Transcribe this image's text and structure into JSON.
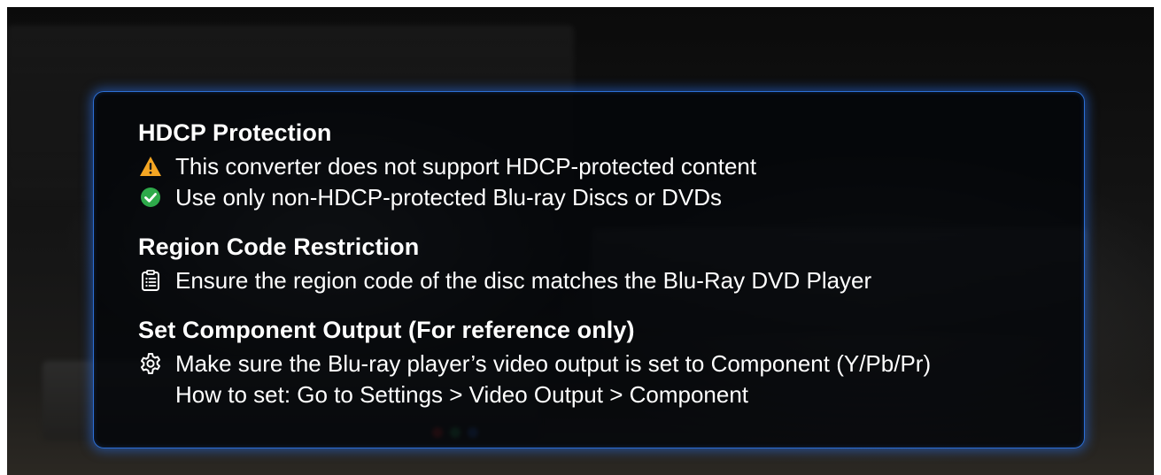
{
  "sections": [
    {
      "title": "HDCP Protection",
      "lines": [
        {
          "icon": "warning-icon",
          "text": "This converter does not support HDCP-protected content"
        },
        {
          "icon": "check-circle-icon",
          "text": "Use only non-HDCP-protected Blu-ray Discs or DVDs"
        }
      ]
    },
    {
      "title": "Region Code Restriction",
      "lines": [
        {
          "icon": "clipboard-list-icon",
          "text": "Ensure the region code of the disc matches the Blu-Ray DVD Player"
        }
      ]
    },
    {
      "title": "Set Component Output (For reference only)",
      "lines": [
        {
          "icon": "gear-icon",
          "text": "Make sure the Blu-ray player’s video output is set to Component (Y/Pb/Pr)"
        },
        {
          "icon": "",
          "text": "How to set: Go to Settings > Video Output > Component"
        }
      ]
    }
  ],
  "colors": {
    "panel_border": "#2c6fd6",
    "warning": "#f5a623",
    "check": "#2eaa4a",
    "text": "#ffffff"
  }
}
